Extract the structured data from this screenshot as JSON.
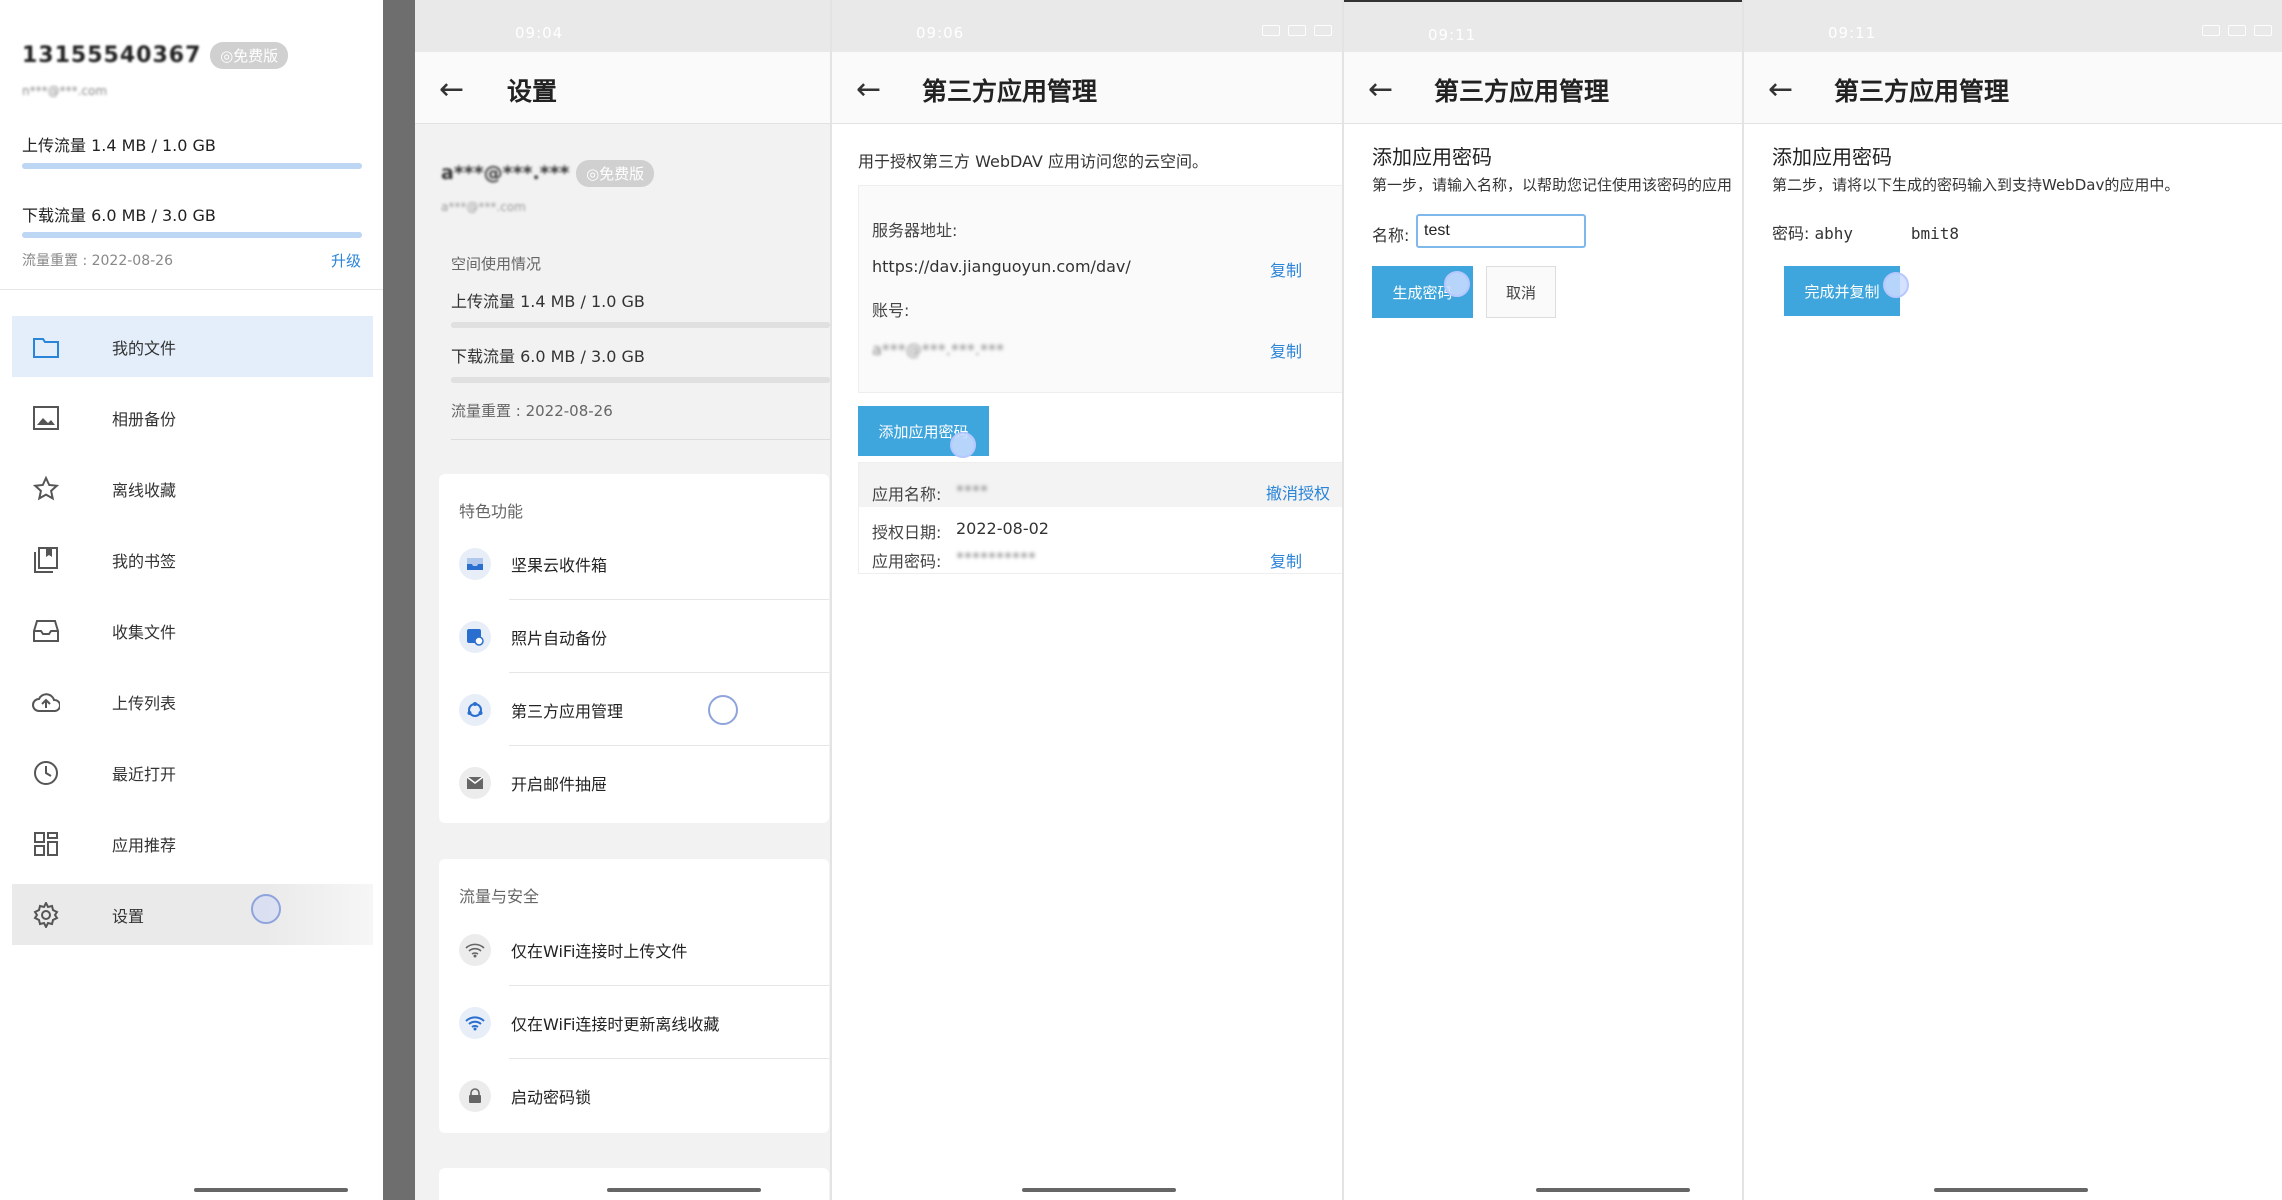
{
  "drawer": {
    "account": "13155540367",
    "badge": "◎免费版",
    "email": "n***@***.com",
    "upload_quota": "上传流量 1.4 MB / 1.0 GB",
    "upload_fraction": 0.0014,
    "download_quota": "下载流量 6.0 MB / 3.0 GB",
    "download_fraction": 0.002,
    "reset": "流量重置 : 2022-08-26",
    "upgrade": "升级",
    "items": [
      {
        "label": "我的文件",
        "icon": "folder-icon"
      },
      {
        "label": "相册备份",
        "icon": "image-icon"
      },
      {
        "label": "离线收藏",
        "icon": "star-icon"
      },
      {
        "label": "我的书签",
        "icon": "bookmark-icon"
      },
      {
        "label": "收集文件",
        "icon": "inbox-icon"
      },
      {
        "label": "上传列表",
        "icon": "cloud-upload-icon"
      },
      {
        "label": "最近打开",
        "icon": "clock-icon"
      },
      {
        "label": "应用推荐",
        "icon": "grid-icon"
      },
      {
        "label": "设置",
        "icon": "gear-icon"
      }
    ]
  },
  "settings": {
    "time": "09:04",
    "title": "设置",
    "account": "a***@***.***",
    "badge": "◎免费版",
    "email": "a***@***.com",
    "usage_label": "空间使用情况",
    "upload_quota": "上传流量 1.4 MB / 1.0 GB",
    "download_quota": "下载流量 6.0 MB / 3.0 GB",
    "reset": "流量重置 : 2022-08-26",
    "features_title": "特色功能",
    "features": [
      {
        "label": "坚果云收件箱",
        "icon": "inbox-tray-icon"
      },
      {
        "label": "照片自动备份",
        "icon": "photo-backup-icon"
      },
      {
        "label": "第三方应用管理",
        "icon": "sync-apps-icon"
      },
      {
        "label": "开启邮件抽屉",
        "icon": "mail-icon"
      }
    ],
    "security_title": "流量与安全",
    "security": [
      {
        "label": "仅在WiFi连接时上传文件",
        "icon": "wifi-upload-icon"
      },
      {
        "label": "仅在WiFi连接时更新离线收藏",
        "icon": "wifi-icon"
      },
      {
        "label": "启动密码锁",
        "icon": "lock-icon"
      }
    ]
  },
  "app_manage": {
    "time": "09:06",
    "title": "第三方应用管理",
    "description": "用于授权第三方 WebDAV 应用访问您的云空间。",
    "server_label": "服务器地址:",
    "server_url": "https://dav.jianguoyun.com/dav/",
    "copy": "复制",
    "account_label": "账号:",
    "account_value": "a***@***.***.***",
    "add_button": "添加应用密码",
    "app_name_label": "应用名称:",
    "app_name_value": "****",
    "revoke": "撤消授权",
    "auth_date_label": "授权日期:",
    "auth_date_value": "2022-08-02",
    "app_pw_label": "应用密码:",
    "app_pw_value": "**********"
  },
  "add_step1": {
    "time": "09:11",
    "title": "第三方应用管理",
    "heading": "添加应用密码",
    "step": "第一步，请输入名称，以帮助您记住使用该密码的应用",
    "name_label": "名称:",
    "name_value": "test",
    "generate": "生成密码",
    "cancel": "取消"
  },
  "add_step2": {
    "time": "09:11",
    "title": "第三方应用管理",
    "heading": "添加应用密码",
    "step": "第二步，请将以下生成的密码输入到支持WebDav的应用中。",
    "pw_label": "密码:",
    "pw_value": "abhy      bmit8",
    "finish": "完成并复制"
  }
}
